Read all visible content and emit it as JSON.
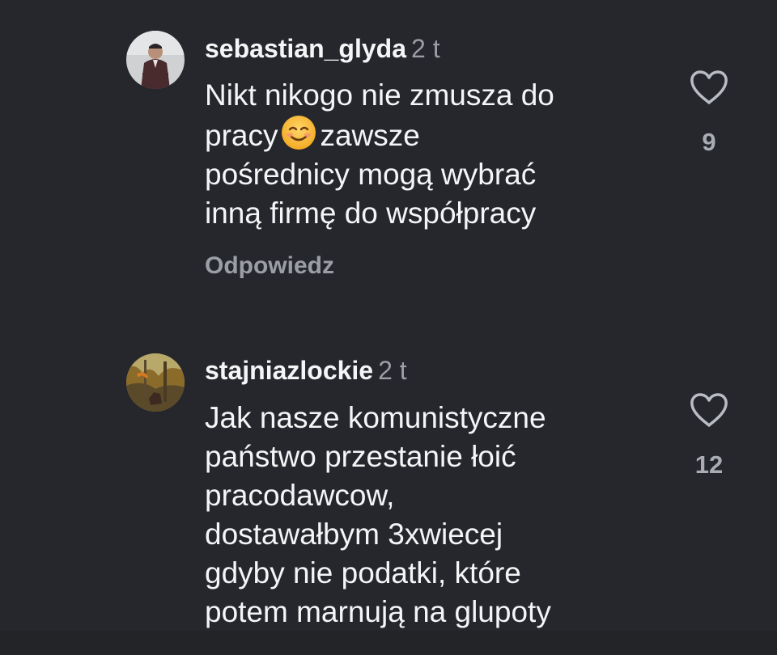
{
  "comments": [
    {
      "username": "sebastian_glyda",
      "time": "2 t",
      "lines": [
        "Nikt nikogo nie zmusza do",
        "pracy",
        "zawsze",
        "pośrednicy mogą wybrać",
        "inną firmę do współpracy"
      ],
      "emoji": "smiling-face-emoji",
      "reply_label": "Odpowiedz",
      "like_count": "9",
      "like_icon": "heart-outline-icon"
    },
    {
      "username": "stajniazlockie",
      "time": "2 t",
      "lines": [
        "Jak nasze komunistyczne",
        "państwo przestanie łoić",
        "pracodawcow,",
        "dostawałbym 3xwiecej",
        "gdyby nie podatki, które",
        "potem marnują na glupoty"
      ],
      "like_count": "12",
      "like_icon": "heart-outline-icon"
    }
  ],
  "colors": {
    "background": "#25272c",
    "primary_text": "#f4f5f7",
    "secondary_text": "#9b9ea5"
  }
}
